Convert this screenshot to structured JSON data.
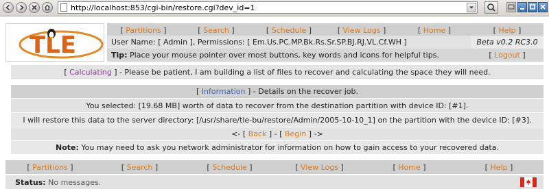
{
  "browser": {
    "url": "http://localhost:853/cgi-bin/restore.cgi?dev_id=1"
  },
  "logo": {
    "text": "TLE"
  },
  "top_nav": [
    "Partitions",
    "Search",
    "Schedule",
    "View Logs",
    "Home",
    "Help"
  ],
  "user_info": {
    "user_name_label": "User Name:",
    "user_name": "Admin",
    "permissions_label": "Permissions:",
    "permissions": "Em.Us.PC.MP.Bk.Rs.Sr.SP.BJ.RJ.VL.Cf.WH",
    "version": "Beta v0.2 RC3.0"
  },
  "tip": {
    "label": "Tip:",
    "text": "Place your mouse pointer over most buttons, key words and icons for helpful tips.",
    "logout": "Logout"
  },
  "calculating": {
    "label": "Calculating",
    "text": "- Please be patient, I am building a list of files to recover and calculating the space they will need."
  },
  "information": {
    "label": "Information",
    "text": "- Details on the recover job."
  },
  "details": {
    "line1": "You selected: [19.68 MB] worth of data to recover from the destination partition with device ID: [#1].",
    "line2": "I will restore this data to the server directory: [/usr/share/tle-bu/restore/Admin/2005-10-10_1] on the partition with the device ID: [#3]."
  },
  "nav_links": {
    "prefix": "<-",
    "back": "Back",
    "sep": "-",
    "begin": "Begin",
    "suffix": "->"
  },
  "note": {
    "label": "Note:",
    "text": "You may need to ask you network administrator for information on how to gain access to your recovered data."
  },
  "bottom_nav": [
    "Partitions",
    "Search",
    "Schedule",
    "View Logs",
    "Home",
    "Help"
  ],
  "status": {
    "label": "Status:",
    "text": "No messages."
  },
  "colors": {
    "link": "#d47a22",
    "calculating": "#8a3c9c",
    "information": "#3d5fa8"
  }
}
